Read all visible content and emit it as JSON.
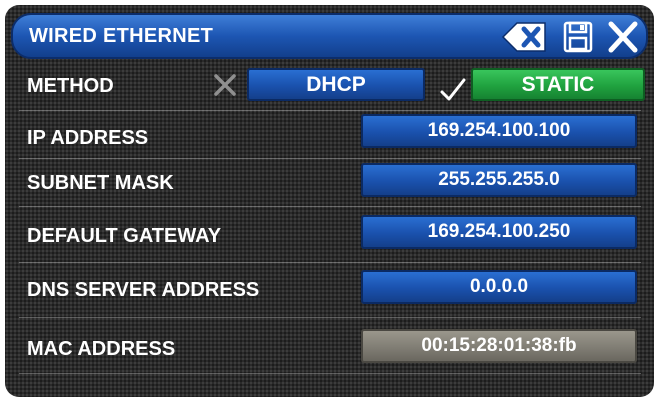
{
  "header": {
    "title": "WIRED ETHERNET",
    "icons": [
      "backspace-icon",
      "save-icon",
      "close-icon"
    ]
  },
  "method": {
    "label": "METHOD",
    "options": [
      {
        "label": "DHCP",
        "selected": false,
        "indicator": "x-mark-icon"
      },
      {
        "label": "STATIC",
        "selected": true,
        "indicator": "checkmark-icon"
      }
    ]
  },
  "fields": [
    {
      "label": "IP ADDRESS",
      "value": "169.254.100.100",
      "editable": true
    },
    {
      "label": "SUBNET MASK",
      "value": "255.255.255.0",
      "editable": true
    },
    {
      "label": "DEFAULT GATEWAY",
      "value": "169.254.100.250",
      "editable": true
    },
    {
      "label": "DNS SERVER ADDRESS",
      "value": "0.0.0.0",
      "editable": true
    },
    {
      "label": "MAC ADDRESS",
      "value": "00:15:28:01:38:fb",
      "editable": false
    }
  ],
  "colors": {
    "field_blue": "#1a51ad",
    "static_green": "#20a23f",
    "readonly_gray": "#7e7b72",
    "background": "#2a2a2a"
  }
}
